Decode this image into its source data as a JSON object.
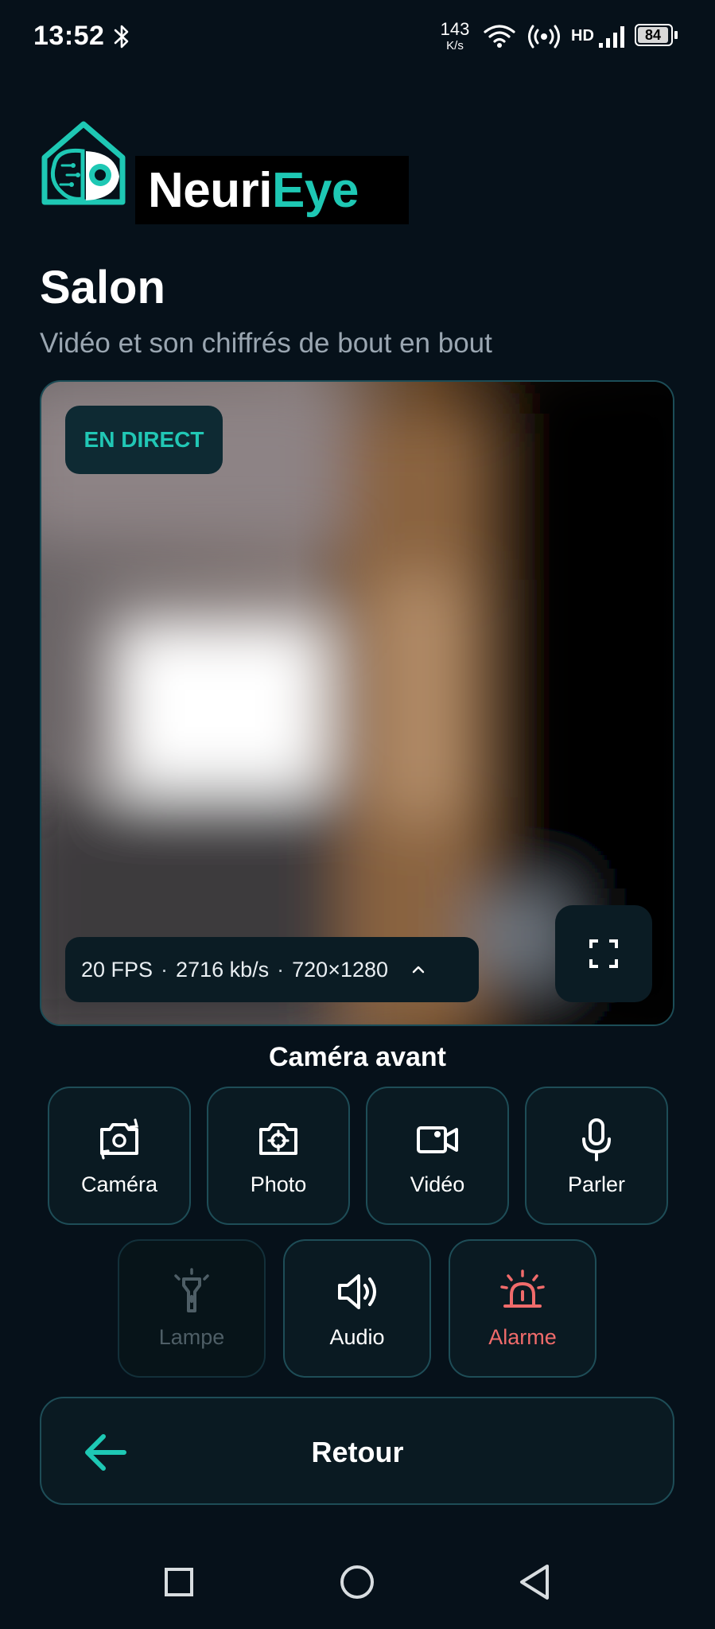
{
  "status_bar": {
    "time": "13:52",
    "net_speed_value": "143",
    "net_speed_unit": "K/s",
    "network_label": "HD",
    "battery_level": "84",
    "icons": [
      "bluetooth-icon",
      "wifi-icon",
      "hotspot-icon",
      "signal-icon",
      "battery-icon"
    ]
  },
  "brand": {
    "name_part1": "Neuri",
    "name_part2": "Eye",
    "accent_color": "#1ec8b4"
  },
  "page": {
    "title": "Salon",
    "subtitle": "Vidéo et son chiffrés de bout en bout"
  },
  "video": {
    "live_badge": "EN DIRECT",
    "fps": "20 FPS",
    "bitrate": "2716 kb/s",
    "resolution": "720×1280",
    "separator": "·",
    "stats_toggle_icon": "chevron-up-icon",
    "fullscreen_icon": "fullscreen-icon"
  },
  "camera": {
    "label": "Caméra avant"
  },
  "actions": {
    "row1": [
      {
        "label": "Caméra",
        "icon": "switch-camera-icon"
      },
      {
        "label": "Photo",
        "icon": "capture-photo-icon"
      },
      {
        "label": "Vidéo",
        "icon": "video-record-icon"
      },
      {
        "label": "Parler",
        "icon": "microphone-icon"
      }
    ],
    "row2": [
      {
        "label": "Lampe",
        "icon": "flashlight-icon",
        "disabled": true
      },
      {
        "label": "Audio",
        "icon": "speaker-icon"
      },
      {
        "label": "Alarme",
        "icon": "siren-icon",
        "color": "#f06b6b"
      }
    ]
  },
  "back": {
    "label": "Retour",
    "icon": "arrow-left-icon"
  },
  "nav_bar": {
    "icons": [
      "recent-apps-icon",
      "home-icon",
      "back-icon"
    ]
  }
}
